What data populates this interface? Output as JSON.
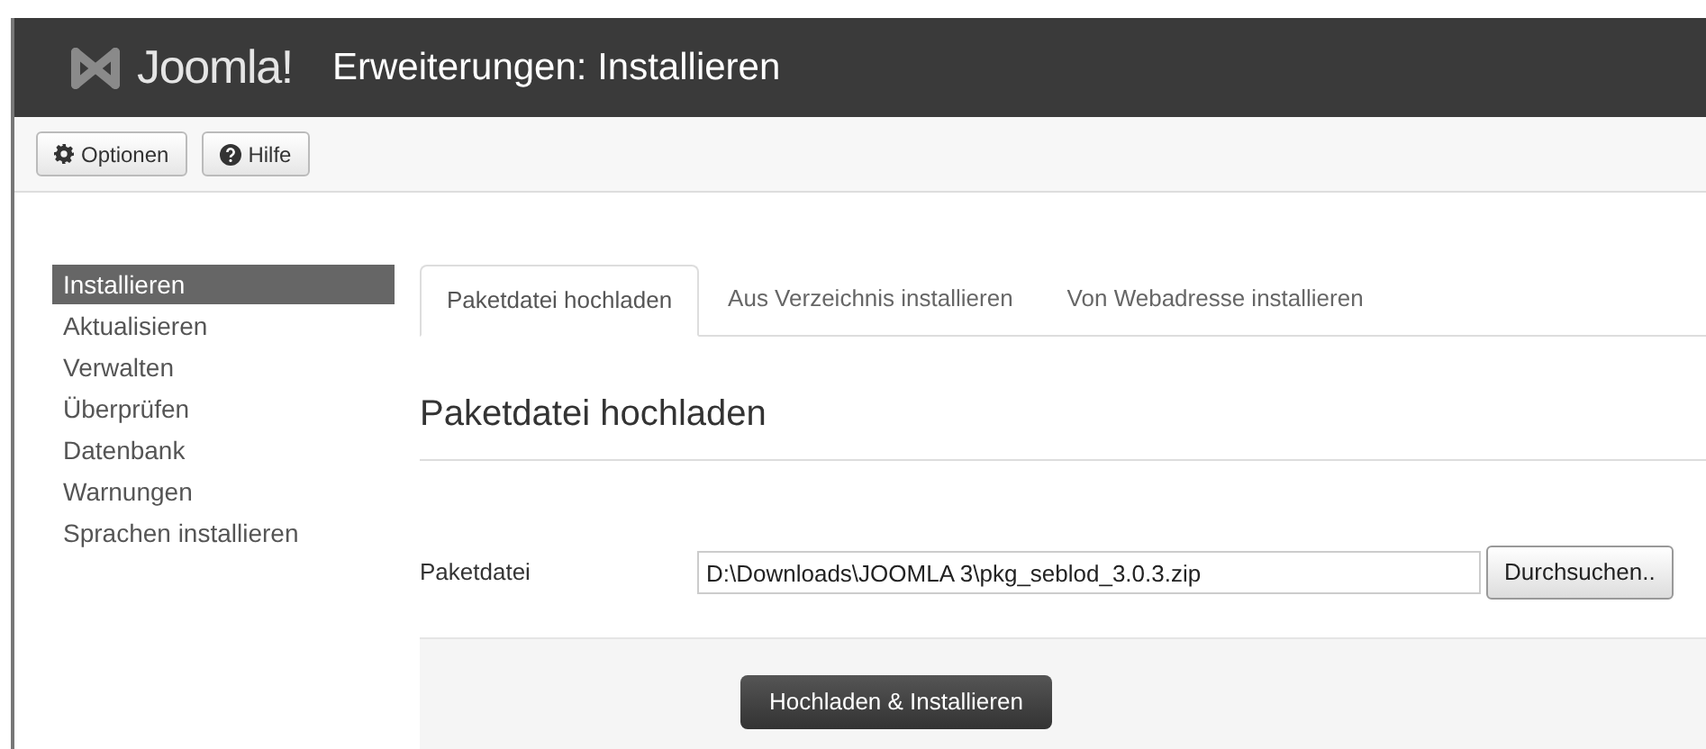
{
  "header": {
    "logo": "Joomla!",
    "title": "Erweiterungen: Installieren"
  },
  "toolbar": [
    {
      "kind": "options",
      "label": "Optionen"
    },
    {
      "kind": "help",
      "label": "Hilfe"
    }
  ],
  "sidebar": {
    "items": [
      {
        "label": "Installieren",
        "selected": true
      },
      {
        "label": "Aktualisieren",
        "selected": false
      },
      {
        "label": "Verwalten",
        "selected": false
      },
      {
        "label": "Überprüfen",
        "selected": false
      },
      {
        "label": "Datenbank",
        "selected": false
      },
      {
        "label": "Warnungen",
        "selected": false
      },
      {
        "label": "Sprachen installieren",
        "selected": false
      }
    ]
  },
  "tabs": [
    {
      "label": "Paketdatei hochladen",
      "selected": true
    },
    {
      "label": "Aus Verzeichnis installieren",
      "selected": false
    },
    {
      "label": "Von Webadresse installieren",
      "selected": false
    }
  ],
  "heading": "Paketdatei hochladen",
  "form": {
    "label": "Paketdatei",
    "value": "D:\\Downloads\\JOOMLA 3\\pkg_seblod_3.0.3.zip",
    "browse": "Durchsuchen.."
  },
  "submit": "Hochladen & Installieren"
}
